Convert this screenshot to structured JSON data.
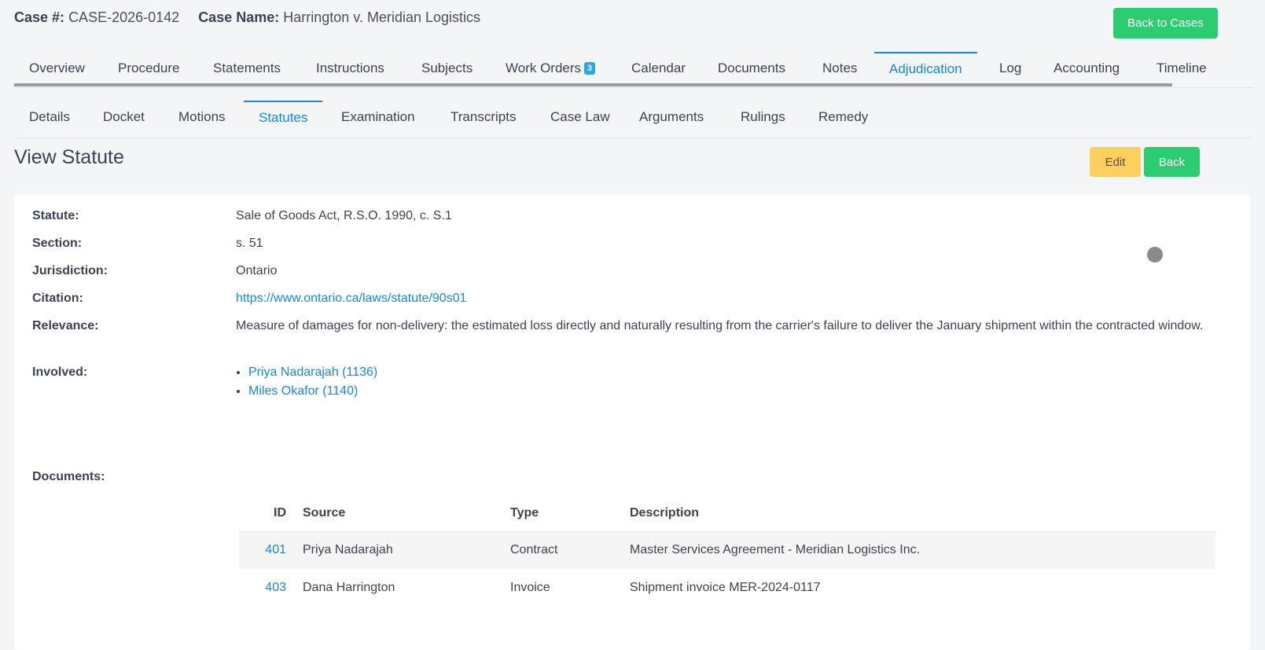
{
  "header": {
    "case_num_label": "Case #:",
    "case_num": "CASE-2026-0142",
    "case_name_label": "Case Name:",
    "case_name": "Harrington v. Meridian Logistics",
    "back_to_cases": "Back to Cases"
  },
  "main_tabs": [
    {
      "label": "Overview"
    },
    {
      "label": "Procedure"
    },
    {
      "label": "Statements"
    },
    {
      "label": "Instructions"
    },
    {
      "label": "Subjects"
    },
    {
      "label": "Work Orders",
      "badge": "3"
    },
    {
      "label": "Calendar"
    },
    {
      "label": "Documents"
    },
    {
      "label": "Notes"
    },
    {
      "label": "Adjudication",
      "active": true
    },
    {
      "label": "Log"
    },
    {
      "label": "Accounting"
    },
    {
      "label": "Timeline"
    }
  ],
  "sub_tabs": [
    {
      "label": "Details"
    },
    {
      "label": "Docket"
    },
    {
      "label": "Motions"
    },
    {
      "label": "Statutes",
      "active": true
    },
    {
      "label": "Examination"
    },
    {
      "label": "Transcripts"
    },
    {
      "label": "Case Law"
    },
    {
      "label": "Arguments"
    },
    {
      "label": "Rulings"
    },
    {
      "label": "Remedy"
    }
  ],
  "page": {
    "title": "View Statute",
    "edit_label": "Edit",
    "back_label": "Back"
  },
  "statute": {
    "statute_label": "Statute:",
    "statute": "Sale of Goods Act, R.S.O. 1990, c. S.1",
    "section_label": "Section:",
    "section": "s. 51",
    "jurisdiction_label": "Jurisdiction:",
    "jurisdiction": "Ontario",
    "citation_label": "Citation:",
    "citation": "https://www.ontario.ca/laws/statute/90s01",
    "relevance_label": "Relevance:",
    "relevance": "Measure of damages for non-delivery: the estimated loss directly and naturally resulting from the carrier's failure to deliver the January shipment within the contracted window.",
    "involved_label": "Involved:",
    "involved": [
      "Priya Nadarajah (1136)",
      "Miles Okafor (1140)"
    ],
    "documents_label": "Documents:"
  },
  "documents": {
    "headers": {
      "id": "ID",
      "source": "Source",
      "type": "Type",
      "description": "Description"
    },
    "rows": [
      {
        "id": "401",
        "source": "Priya Nadarajah",
        "type": "Contract",
        "description": "Master Services Agreement - Meridian Logistics Inc."
      },
      {
        "id": "403",
        "source": "Dana Harrington",
        "type": "Invoice",
        "description": "Shipment invoice MER-2024-0117"
      }
    ]
  },
  "colors": {
    "accent": "#1787d6",
    "green": "#2ecc71",
    "yellow": "#fccf5f",
    "badge": "#2aa7de"
  }
}
